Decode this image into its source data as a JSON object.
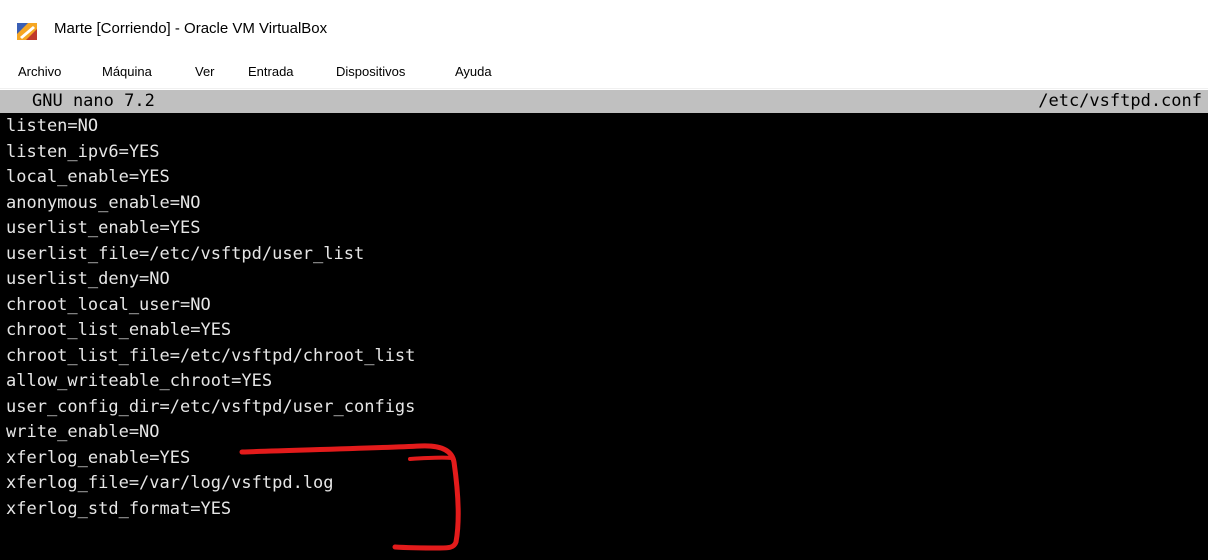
{
  "window": {
    "title": "Marte [Corriendo] - Oracle VM VirtualBox",
    "app_icon": "virtualbox-icon"
  },
  "menubar": {
    "items": [
      "Archivo",
      "Máquina",
      "Ver",
      "Entrada",
      "Dispositivos",
      "Ayuda"
    ]
  },
  "nano": {
    "version": "GNU nano 7.2",
    "filename": "/etc/vsftpd.conf",
    "lines": [
      "listen=NO",
      "listen_ipv6=YES",
      "local_enable=YES",
      "anonymous_enable=NO",
      "userlist_enable=YES",
      "userlist_file=/etc/vsftpd/user_list",
      "userlist_deny=NO",
      "chroot_local_user=NO",
      "chroot_list_enable=YES",
      "chroot_list_file=/etc/vsftpd/chroot_list",
      "allow_writeable_chroot=YES",
      "user_config_dir=/etc/vsftpd/user_configs",
      "write_enable=NO",
      "xferlog_enable=YES",
      "xferlog_file=/var/log/vsftpd.log",
      "xferlog_std_format=YES"
    ]
  },
  "colors": {
    "terminal_bg": "#000000",
    "terminal_fg": "#e6e6e6",
    "header_bg": "#c0c0c0",
    "annotation": "#e31b1b"
  }
}
